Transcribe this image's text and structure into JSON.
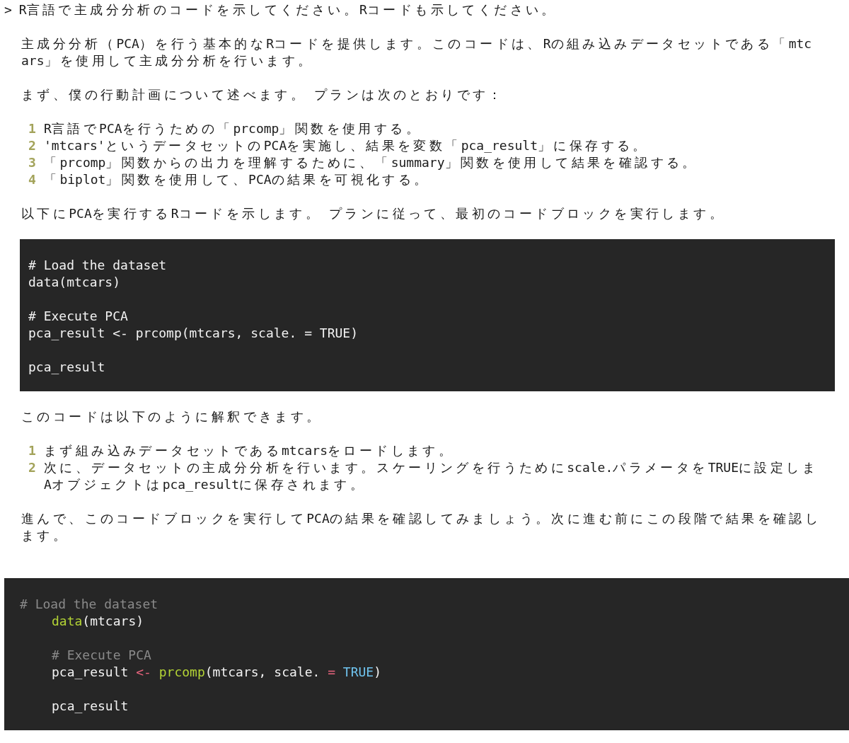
{
  "prompt": {
    "symbol": ">",
    "text": "R言語で主成分分析のコードを示してください。Rコードも示してください。"
  },
  "blocks": [
    {
      "kind": "paragraph",
      "lines": [
        "主成分分析（PCA）を行う基本的なRコードを提供します。このコードは、Rの組み込みデータセットである「mtc",
        "ars」を使用して主成分分析を行います。"
      ]
    },
    {
      "kind": "paragraph",
      "lines": [
        "まず、僕の行動計画について述べます。 プランは次のとおりです："
      ]
    },
    {
      "kind": "list",
      "items": [
        {
          "number": "1",
          "lines": [
            "R言語でPCAを行うための「prcomp」関数を使用する。"
          ]
        },
        {
          "number": "2",
          "lines": [
            "'mtcars'というデータセットのPCAを実施し、結果を変数「pca_result」に保存する。"
          ]
        },
        {
          "number": "3",
          "lines": [
            "「prcomp」関数からの出力を理解するために、「summary」関数を使用して結果を確認する。"
          ]
        },
        {
          "number": "4",
          "lines": [
            "「biplot」関数を使用して、PCAの結果を可視化する。"
          ]
        }
      ]
    },
    {
      "kind": "paragraph",
      "lines": [
        "以下にPCAを実行するRコードを示します。 プランに従って、最初のコードブロックを実行します。"
      ]
    },
    {
      "kind": "code",
      "groups": [
        {
          "lines": [
            {
              "indented": false,
              "tokens": [
                {
                  "text": "# Load the dataset",
                  "kind": "plain"
                }
              ]
            },
            {
              "indented": false,
              "tokens": [
                {
                  "text": "data(mtcars)",
                  "kind": "plain"
                }
              ]
            }
          ]
        },
        {
          "lines": [
            {
              "indented": false,
              "tokens": [
                {
                  "text": "# Execute PCA",
                  "kind": "plain"
                }
              ]
            },
            {
              "indented": false,
              "tokens": [
                {
                  "text": "pca_result <- prcomp(mtcars, scale. = TRUE)",
                  "kind": "plain"
                }
              ]
            }
          ]
        },
        {
          "lines": [
            {
              "indented": false,
              "tokens": [
                {
                  "text": "pca_result",
                  "kind": "plain"
                }
              ]
            }
          ]
        }
      ]
    },
    {
      "kind": "paragraph",
      "lines": [
        "このコードは以下のように解釈できます。"
      ]
    },
    {
      "kind": "list",
      "items": [
        {
          "number": "1",
          "lines": [
            "まず組み込みデータセットであるmtcarsをロードします。"
          ]
        },
        {
          "number": "2",
          "lines": [
            "次に、データセットの主成分分析を行います。スケーリングを行うためにscale.パラメータをTRUEに設定しま",
            "Aオブジェクトはpca_resultに保存されます。"
          ]
        }
      ]
    },
    {
      "kind": "paragraph",
      "lines": [
        "進んで、このコードブロックを実行してPCAの結果を確認してみましょう。次に進む前にこの段階で結果を確認し",
        "ます。"
      ]
    },
    {
      "kind": "highlighted_code",
      "groups": [
        {
          "lines": [
            {
              "indented": false,
              "tokens": [
                {
                  "text": "# Load the dataset",
                  "kind": "comment"
                }
              ]
            },
            {
              "indented": true,
              "tokens": [
                {
                  "text": "data",
                  "kind": "function"
                },
                {
                  "text": "(mtcars)",
                  "kind": "plain"
                }
              ]
            }
          ]
        },
        {
          "lines": [
            {
              "indented": true,
              "tokens": [
                {
                  "text": "# Execute PCA",
                  "kind": "comment"
                }
              ]
            },
            {
              "indented": true,
              "tokens": [
                {
                  "text": "pca_result ",
                  "kind": "plain"
                },
                {
                  "text": "<- ",
                  "kind": "operator"
                },
                {
                  "text": "prcomp",
                  "kind": "function"
                },
                {
                  "text": "(mtcars, scale. ",
                  "kind": "plain"
                },
                {
                  "text": "= ",
                  "kind": "operator"
                },
                {
                  "text": "TRUE",
                  "kind": "constant"
                },
                {
                  "text": ")",
                  "kind": "plain"
                }
              ]
            }
          ]
        },
        {
          "lines": [
            {
              "indented": true,
              "tokens": [
                {
                  "text": "pca_result",
                  "kind": "plain"
                }
              ]
            }
          ]
        }
      ]
    }
  ]
}
